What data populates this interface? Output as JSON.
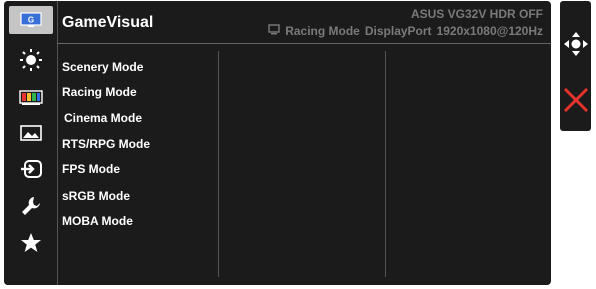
{
  "header": {
    "title": "GameVisual",
    "model": "ASUS VG32V HDR OFF",
    "status": {
      "mode": "Racing Mode",
      "input": "DisplayPort",
      "resolution": "1920x1080@120Hz"
    }
  },
  "sidebar": {
    "items": [
      {
        "icon": "gamevisual-icon",
        "active": true
      },
      {
        "icon": "brightness-icon"
      },
      {
        "icon": "color-icon"
      },
      {
        "icon": "image-icon"
      },
      {
        "icon": "input-select-icon"
      },
      {
        "icon": "system-setup-icon"
      },
      {
        "icon": "myfavorite-icon"
      }
    ]
  },
  "modes": [
    "Scenery Mode",
    "Racing Mode",
    "Cinema Mode",
    "RTS/RPG Mode",
    "FPS Mode",
    "sRGB Mode",
    "MOBA Mode"
  ],
  "side_panel": {
    "icons": [
      "navigate-joystick-icon",
      "close-icon"
    ]
  },
  "colors": {
    "osd_background": "#1b1b1b",
    "close_red": "#e8322e",
    "text": "#ffffff",
    "muted_text": "#7a7a7a"
  }
}
